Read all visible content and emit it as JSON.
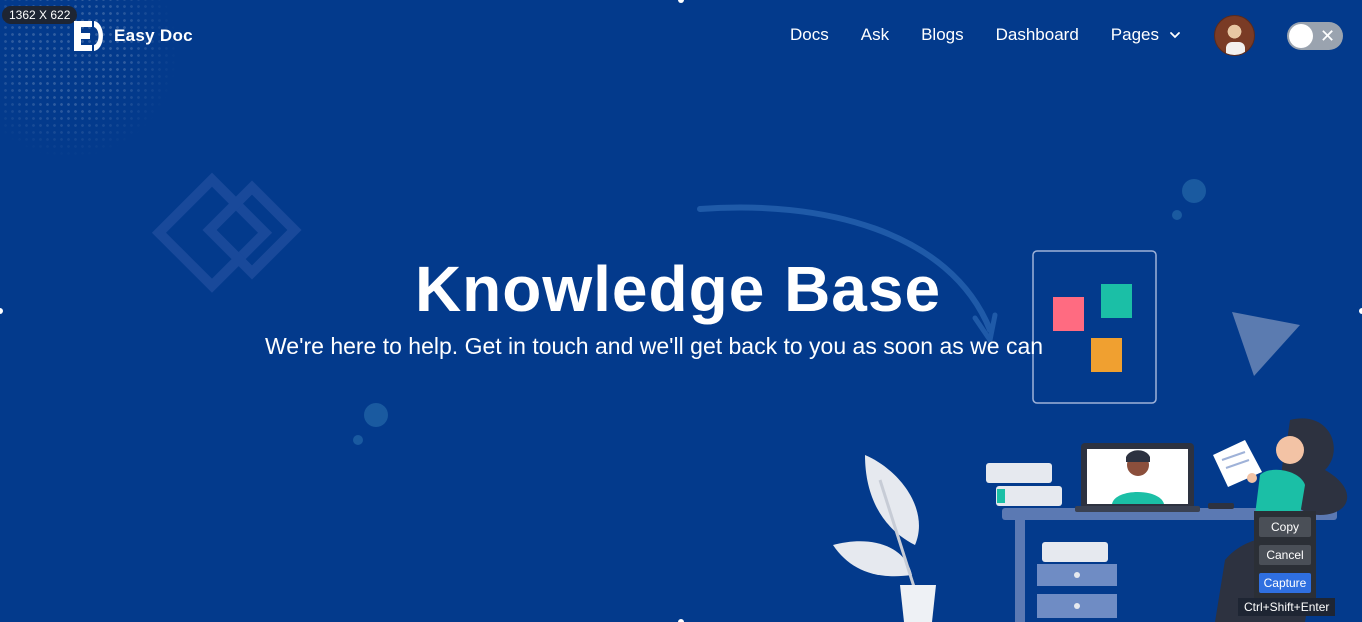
{
  "screenshot_size_label": "1362 X 622",
  "brand": {
    "name": "Easy Doc"
  },
  "nav": {
    "items": [
      {
        "label": "Docs"
      },
      {
        "label": "Ask"
      },
      {
        "label": "Blogs"
      },
      {
        "label": "Dashboard"
      },
      {
        "label": "Pages"
      }
    ]
  },
  "hero": {
    "title": "Knowledge Base",
    "subtitle": "We're here to help. Get in touch and we'll get back to you as soon as we can"
  },
  "capture_menu": {
    "copy": "Copy",
    "cancel": "Cancel",
    "capture": "Capture",
    "shortcut": "Ctrl+Shift+Enter"
  },
  "icons": [
    "logo-icon",
    "chevron-down-icon",
    "avatar",
    "close-icon"
  ],
  "colors": {
    "background": "#033a8c",
    "text": "#ffffff",
    "toggle_track": "#9aa3af",
    "capture_button": "#2f6fe0"
  }
}
